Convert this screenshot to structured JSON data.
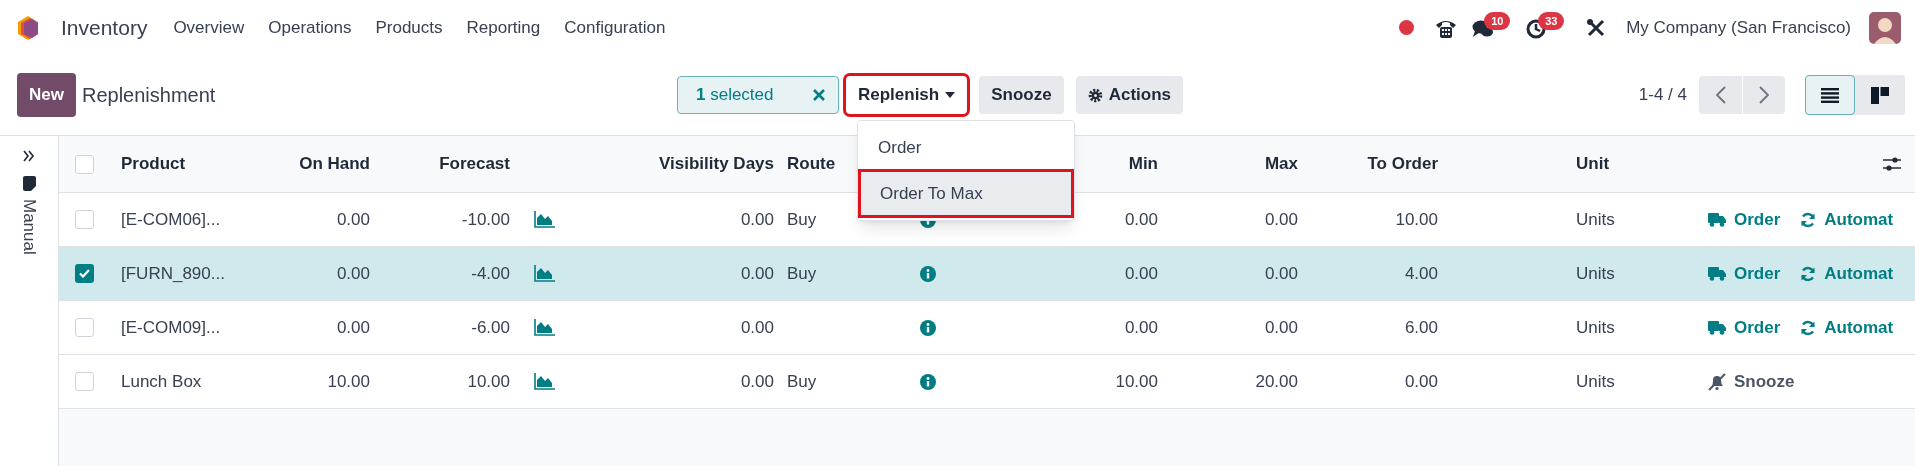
{
  "app": {
    "name": "Inventory",
    "menu": [
      "Overview",
      "Operations",
      "Products",
      "Reporting",
      "Configuration"
    ]
  },
  "systray": {
    "messages_badge": "10",
    "activities_badge": "33",
    "company": "My Company (San Francisco)"
  },
  "control_panel": {
    "new_button": "New",
    "title": "Replenishment",
    "selection": {
      "count": "1",
      "label": "selected"
    },
    "buttons": [
      {
        "kind": "dropdown",
        "label": "Replenish",
        "highlighted": true
      },
      {
        "kind": "plain",
        "label": "Snooze"
      },
      {
        "kind": "actions",
        "label": "Actions"
      }
    ],
    "pager": "1-4 / 4",
    "views": [
      {
        "kind": "list",
        "selected": true
      },
      {
        "kind": "kanban",
        "selected": false
      }
    ]
  },
  "dropdown": {
    "items": [
      {
        "label": "Order",
        "selected": false
      },
      {
        "label": "Order To Max",
        "selected": true
      }
    ]
  },
  "side_panel": {
    "label": "Manual"
  },
  "table": {
    "select_all": false,
    "columns": [
      "Product",
      "On Hand",
      "Forecast",
      "Visibility Days",
      "Route",
      "Min",
      "Max",
      "To Order",
      "Unit"
    ],
    "rows": [
      {
        "selected": false,
        "product": "[E-COM06]...",
        "on_hand": "0.00",
        "forecast": "-10.00",
        "visibility_days": "0.00",
        "route": "Buy",
        "min": "0.00",
        "max": "0.00",
        "to_order": "10.00",
        "unit": "Units",
        "actions": [
          {
            "kind": "order",
            "label": "Order"
          },
          {
            "kind": "automate",
            "label": "Automat"
          }
        ]
      },
      {
        "selected": true,
        "product": "[FURN_890...",
        "on_hand": "0.00",
        "forecast": "-4.00",
        "visibility_days": "0.00",
        "route": "Buy",
        "min": "0.00",
        "max": "0.00",
        "to_order": "4.00",
        "unit": "Units",
        "actions": [
          {
            "kind": "order",
            "label": "Order"
          },
          {
            "kind": "automate",
            "label": "Automat"
          }
        ]
      },
      {
        "selected": false,
        "product": "[E-COM09]...",
        "on_hand": "0.00",
        "forecast": "-6.00",
        "visibility_days": "0.00",
        "min": "0.00",
        "max": "0.00",
        "to_order": "6.00",
        "unit": "Units",
        "actions": [
          {
            "kind": "order",
            "label": "Order"
          },
          {
            "kind": "automate",
            "label": "Automat"
          }
        ]
      },
      {
        "selected": false,
        "product": "Lunch Box",
        "on_hand": "10.00",
        "forecast": "10.00",
        "visibility_days": "0.00",
        "route": "Buy",
        "min": "10.00",
        "max": "20.00",
        "to_order": "0.00",
        "unit": "Units",
        "actions": [
          {
            "kind": "snooze",
            "label": "Snooze"
          }
        ]
      }
    ]
  }
}
